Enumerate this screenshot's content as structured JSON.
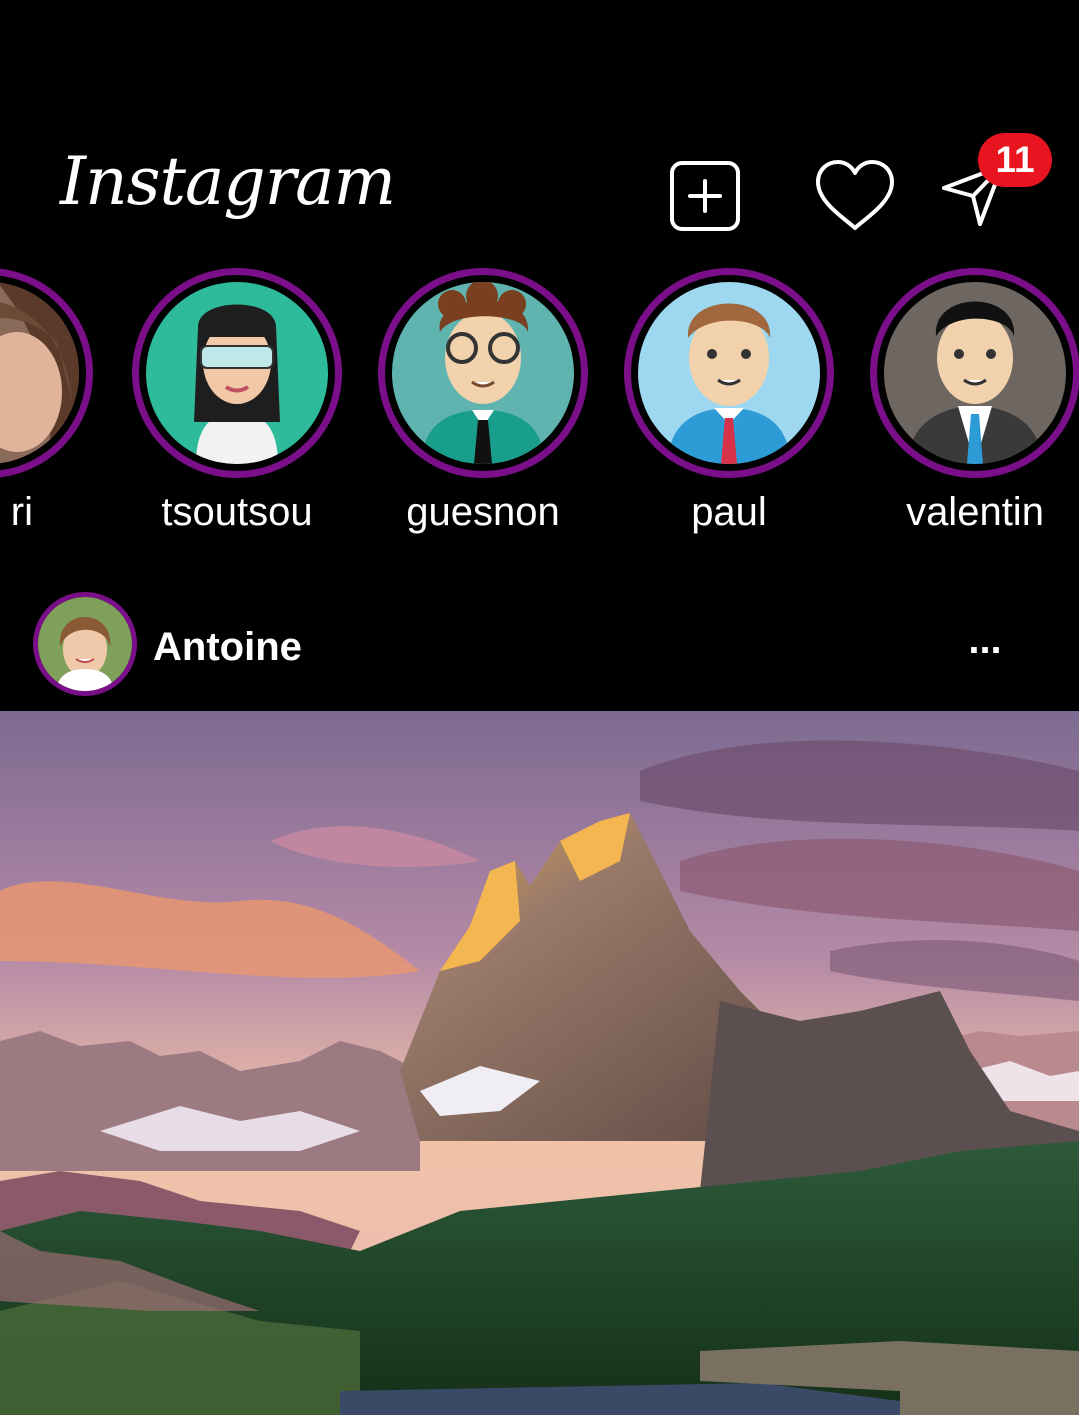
{
  "app": {
    "title": "Instagram"
  },
  "header": {
    "logo_text": "Instagram",
    "icons": [
      "plus-square-icon",
      "heart-icon",
      "paper-plane-icon"
    ],
    "dm_badge_count": "11",
    "badge_color": "#e8141f"
  },
  "stories": [
    {
      "name": "ri"
    },
    {
      "name": "tsoutsou"
    },
    {
      "name": "guesnon"
    },
    {
      "name": "paul"
    },
    {
      "name": "valentin"
    }
  ],
  "story_ring_color": "#7b0f89",
  "post": {
    "username": "Antoine",
    "more_label": "...",
    "image_subject": "mountain-landscape"
  }
}
